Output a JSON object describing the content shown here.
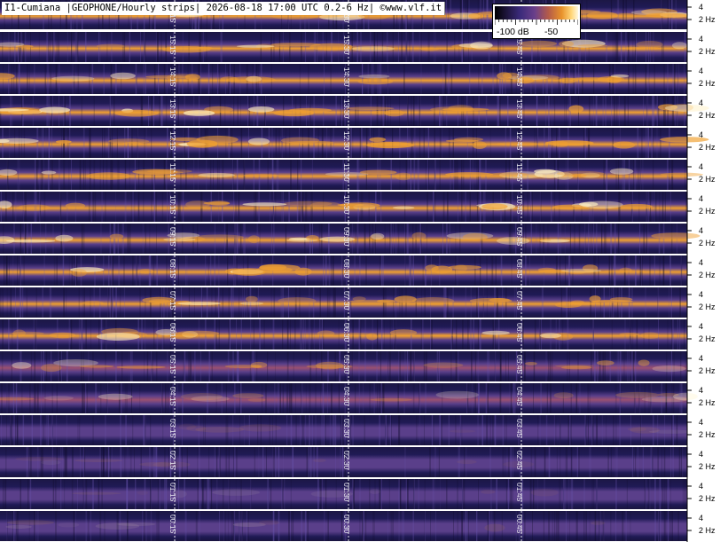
{
  "header": {
    "title": "I1-Cumiana |GEOPHONE/Hourly strips| 2026-08-18 17:00 UTC 0.2-6 Hz| ©www.vlf.it"
  },
  "colorbar": {
    "min_label": "-100 dB",
    "mid_label": "-50"
  },
  "colors": {
    "low": "#1f1a55",
    "mid": "#5a3f8a",
    "high": "#f0a030",
    "peak": "#fff0c0"
  },
  "chart_data": {
    "type": "heatmap",
    "description_free": true,
    "strips": [
      {
        "hour": "16",
        "minute_labels": [
          "16:15",
          "16:30",
          "16:45"
        ],
        "intensity": 0.85,
        "partial": true
      },
      {
        "hour": "15",
        "minute_labels": [
          "15:15",
          "15:30",
          "15:45"
        ],
        "intensity": 0.8
      },
      {
        "hour": "14",
        "minute_labels": [
          "14:15",
          "14:30",
          "14:45"
        ],
        "intensity": 0.8
      },
      {
        "hour": "13",
        "minute_labels": [
          "13:15",
          "13:30",
          "13:45"
        ],
        "intensity": 0.85
      },
      {
        "hour": "12",
        "minute_labels": [
          "12:15",
          "12:30",
          "12:45"
        ],
        "intensity": 0.9
      },
      {
        "hour": "11",
        "minute_labels": [
          "11:15",
          "11:30",
          "11:45"
        ],
        "intensity": 0.8
      },
      {
        "hour": "10",
        "minute_labels": [
          "10:15",
          "10:30",
          "10:45"
        ],
        "intensity": 0.8
      },
      {
        "hour": "09",
        "minute_labels": [
          "09:15",
          "09:30",
          "09:45"
        ],
        "intensity": 0.8
      },
      {
        "hour": "08",
        "minute_labels": [
          "08:15",
          "08:30",
          "08:45"
        ],
        "intensity": 0.78
      },
      {
        "hour": "07",
        "minute_labels": [
          "07:15",
          "07:30",
          "07:45"
        ],
        "intensity": 0.8
      },
      {
        "hour": "06",
        "minute_labels": [
          "06:15",
          "06:30",
          "06:45"
        ],
        "intensity": 0.7
      },
      {
        "hour": "05",
        "minute_labels": [
          "05:15",
          "05:30",
          "05:45"
        ],
        "intensity": 0.55
      },
      {
        "hour": "04",
        "minute_labels": [
          "04:15",
          "04:30",
          "04:45"
        ],
        "intensity": 0.4
      },
      {
        "hour": "03",
        "minute_labels": [
          "03:15",
          "03:30",
          "03:45"
        ],
        "intensity": 0.12
      },
      {
        "hour": "02",
        "minute_labels": [
          "02:15",
          "02:30",
          "02:45"
        ],
        "intensity": 0.12
      },
      {
        "hour": "01",
        "minute_labels": [
          "01:15",
          "01:30",
          "01:45"
        ],
        "intensity": 0.1
      },
      {
        "hour": "00",
        "minute_labels": [
          "00:15",
          "00:30",
          "00:45"
        ],
        "intensity": 0.15
      }
    ],
    "y_ticks": [
      "4",
      "2 Hz"
    ],
    "color_scale": {
      "min_db": -100,
      "mid_db": -50
    }
  }
}
